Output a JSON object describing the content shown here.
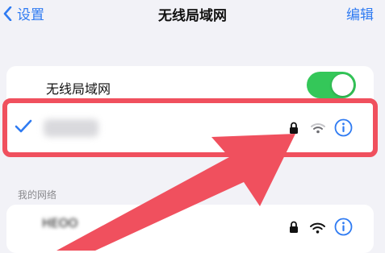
{
  "nav": {
    "back_label": "设置",
    "title": "无线局域网",
    "edit_label": "编辑"
  },
  "wifi_toggle": {
    "label": "无线局域网",
    "state": "on"
  },
  "connected_network": {
    "name_obscured": true,
    "selected": true
  },
  "my_networks": {
    "header": "我的网络",
    "first_partial_name": "HEOO"
  },
  "colors": {
    "accent": "#2f7bf2",
    "toggle_on": "#34c759",
    "annotation_red": "#f0505e"
  },
  "icons": [
    "chevron-left-icon",
    "checkmark-icon",
    "lock-icon",
    "wifi-icon",
    "info-icon"
  ]
}
